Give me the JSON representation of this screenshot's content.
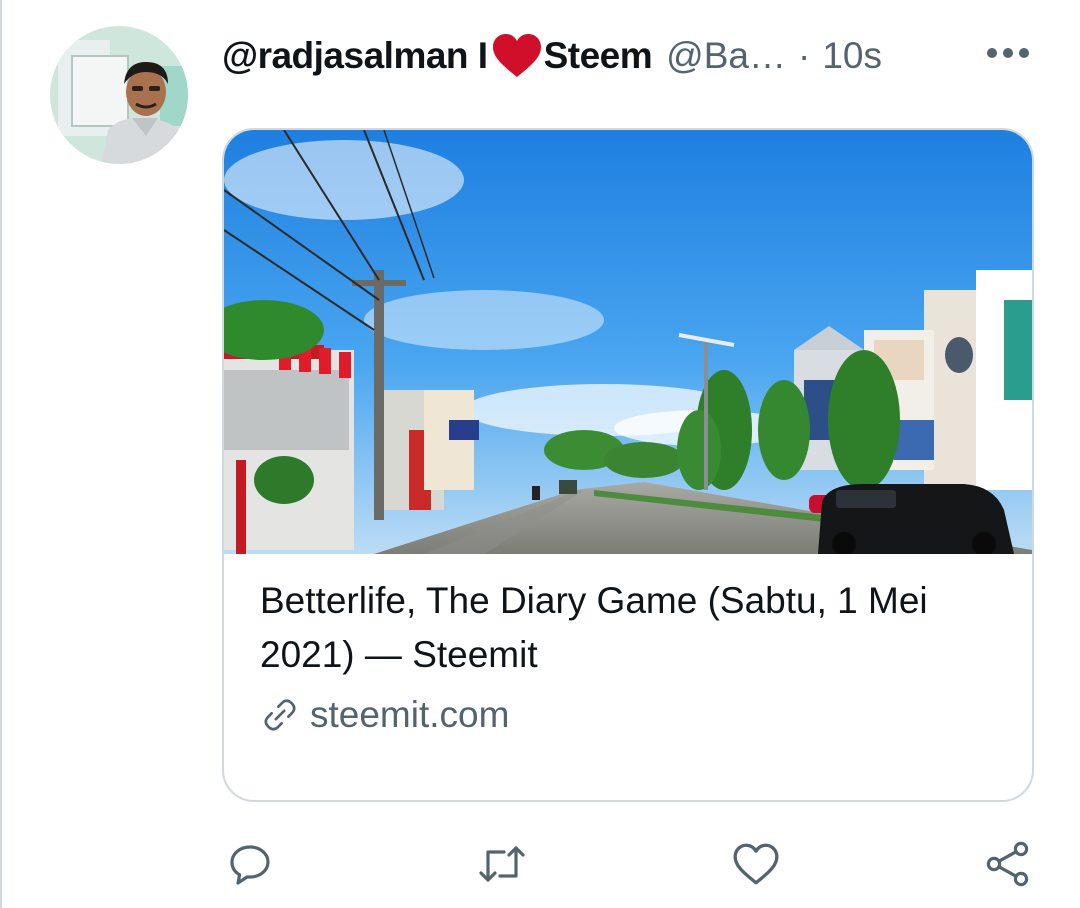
{
  "tweet": {
    "display_name_prefix": "@radjasalman I",
    "display_name_suffix": "Steem",
    "handle": "@Ba…",
    "separator": "·",
    "time": "10s",
    "more_icon": "more-horizontal-icon"
  },
  "card": {
    "title": "Betterlife, The Diary Game (Sabtu, 1 Mei 2021) — Steemit",
    "domain": "steemit.com",
    "link_icon": "link-icon"
  },
  "actions": {
    "reply_icon": "reply-icon",
    "retweet_icon": "retweet-icon",
    "like_icon": "like-icon",
    "share_icon": "share-icon"
  },
  "colors": {
    "heart": "#d0102b",
    "secondary_text": "#536471",
    "border": "#cfd9de"
  }
}
